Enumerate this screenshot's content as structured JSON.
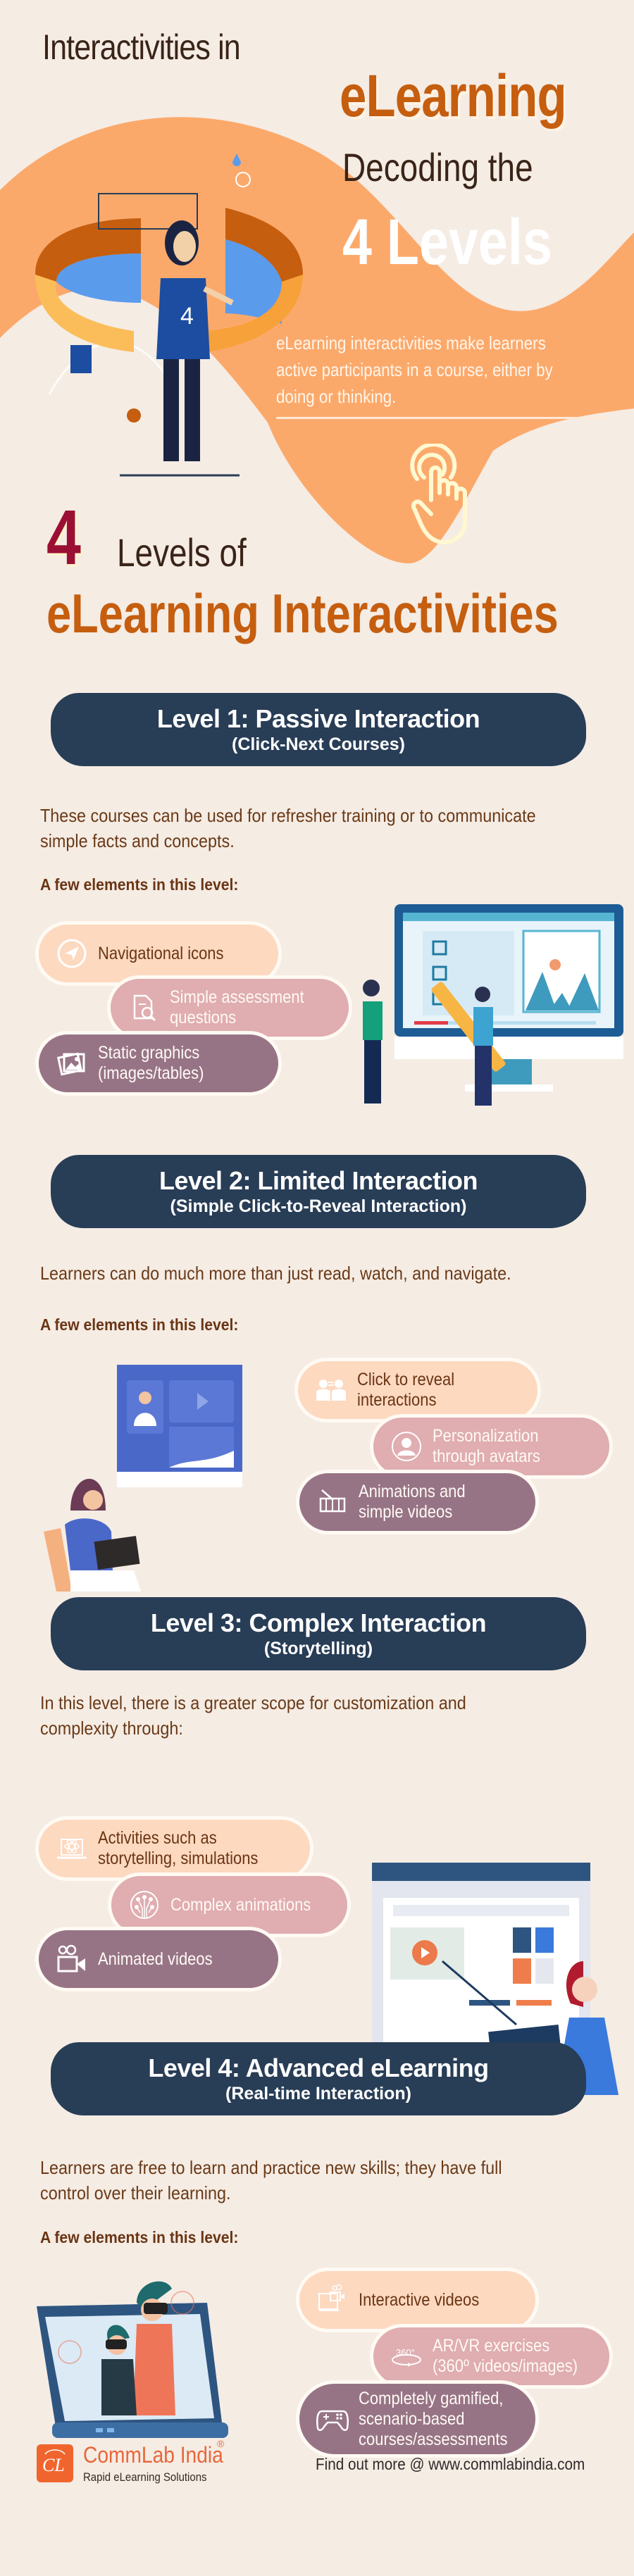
{
  "hero": {
    "title_line1": "Interactivities in",
    "title_line2": "eLearning",
    "title_line3": "Decoding the",
    "title_line4": "4 Levels",
    "description": "eLearning interactivities make learners active participants in a course, either by doing or thinking.",
    "illustration_jersey_number": "4"
  },
  "section_title": {
    "number": "4",
    "line1": "Levels of",
    "line2": "eLearning Interactivities"
  },
  "levels": [
    {
      "title": "Level 1: Passive Interaction",
      "subtitle": "(Click-Next Courses)",
      "description": "These courses can be used for refresher training or to communicate simple facts and concepts.",
      "elements_heading": "A few elements in this level:",
      "elements": [
        {
          "label": "Navigational icons",
          "icon": "navigation-arrow-icon"
        },
        {
          "label": "Simple assessment\nquestions",
          "icon": "document-search-icon"
        },
        {
          "label": "Static graphics\n(images/tables)",
          "icon": "images-icon"
        }
      ]
    },
    {
      "title": "Level 2: Limited Interaction",
      "subtitle": "(Simple Click-to-Reveal Interaction)",
      "description": "Learners can do much more than just read, watch, and navigate.",
      "elements_heading": "A few elements in this level:",
      "elements": [
        {
          "label": "Click to reveal\ninteractions",
          "icon": "people-exchange-icon"
        },
        {
          "label": "Personalization\nthrough avatars",
          "icon": "avatar-icon"
        },
        {
          "label": "Animations and\nsimple videos",
          "icon": "film-strip-icon"
        }
      ]
    },
    {
      "title": "Level 3: Complex Interaction",
      "subtitle": "(Storytelling)",
      "description": "In this level, there is a greater scope for customization and complexity through:",
      "elements": [
        {
          "label": "Activities such as\nstorytelling, simulations",
          "icon": "laptop-atom-icon"
        },
        {
          "label": "Complex animations",
          "icon": "circuit-globe-icon"
        },
        {
          "label": "Animated videos",
          "icon": "video-camera-icon"
        }
      ]
    },
    {
      "title": "Level 4: Advanced eLearning",
      "subtitle": "(Real-time Interaction)",
      "description": "Learners are free to learn and practice new skills; they have full control over their learning.",
      "elements_heading": "A few elements in this level:",
      "elements": [
        {
          "label": "Interactive videos",
          "icon": "interactive-video-icon"
        },
        {
          "label": "AR/VR exercises\n(360º videos/images)",
          "icon": "360-rotate-icon"
        },
        {
          "label": "Completely gamified,\nscenario-based\ncourses/assessments",
          "icon": "gamepad-icon"
        }
      ]
    }
  ],
  "footer": {
    "logo_initials": "CL",
    "brand_name": "CommLab India",
    "registered_mark": "®",
    "tagline": "Rapid eLearning Solutions",
    "find_out_more": "Find out more @ www.commlabindia.com"
  },
  "colors": {
    "background": "#f5ece4",
    "hero_orange": "#fba96b",
    "accent_orange": "#c55e0f",
    "maroon": "#9a0f33",
    "banner_navy": "#283d56",
    "pill_light": "#fdd9c0",
    "pill_rose": "#e0adb0",
    "pill_mauve": "#977485",
    "brand_orange": "#f0652e"
  }
}
